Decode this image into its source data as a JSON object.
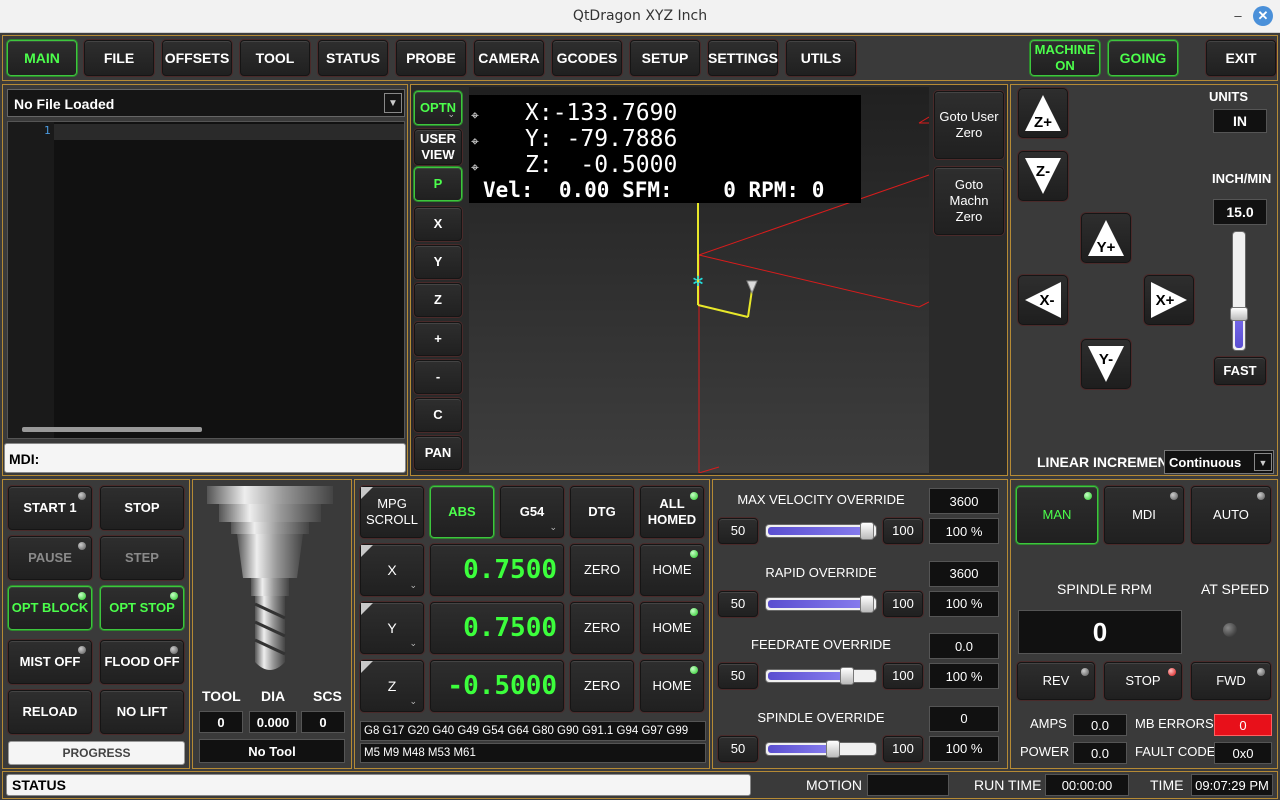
{
  "window": {
    "title": "QtDragon XYZ Inch",
    "minimize_glyph": "–",
    "close_glyph": "✕"
  },
  "tabs": [
    "MAIN",
    "FILE",
    "OFFSETS",
    "TOOL",
    "STATUS",
    "PROBE",
    "CAMERA",
    "GCODES",
    "SETUP",
    "SETTINGS",
    "UTILS"
  ],
  "top_right": {
    "machine_on": "MACHINE ON",
    "going": "GOING",
    "exit": "EXIT"
  },
  "file": {
    "loaded": "No File Loaded",
    "line_number": "1",
    "mdi_label": "MDI:"
  },
  "view_buttons": [
    "OPTN",
    "USER VIEW",
    "P",
    "X",
    "Y",
    "Z",
    "+",
    "-",
    "C",
    "PAN"
  ],
  "dro_overlay": {
    "x": "X:-133.7690",
    "y": "Y: -79.7886",
    "z": "Z:  -0.5000",
    "status_line": "Vel:  0.00 SFM:    0 RPM: 0"
  },
  "goto_buttons": {
    "user_zero": "Goto User Zero",
    "machine_zero": "Goto Machn Zero"
  },
  "jog": {
    "labels": [
      "Z+",
      "Z-",
      "Y+",
      "X-",
      "X+",
      "Y-"
    ],
    "units_label": "UNITS",
    "units_value": "IN",
    "rate_label": "INCH/MIN",
    "rate_value": "15.0",
    "rate_fraction": 0.2,
    "fast_label": "FAST",
    "linear_increment_label": "LINEAR INCREMENT",
    "linear_increment_value": "Continuous"
  },
  "program": {
    "start": "START 1",
    "stop": "STOP",
    "pause": "PAUSE",
    "step": "STEP",
    "opt_block": "OPT BLOCK",
    "opt_stop": "OPT STOP",
    "mist": "MIST OFF",
    "flood": "FLOOD OFF",
    "reload": "RELOAD",
    "no_lift": "NO LIFT",
    "progress": "PROGRESS"
  },
  "tool": {
    "tool_label": "TOOL",
    "dia_label": "DIA",
    "scs_label": "SCS",
    "tool_value": "0",
    "dia_value": "0.000",
    "scs_value": "0",
    "name": "No Tool"
  },
  "dro": {
    "mpg": "MPG SCROLL",
    "abs": "ABS",
    "wcs": "G54",
    "dtg": "DTG",
    "all_homed": "ALL HOMED",
    "axes": [
      {
        "name": "X",
        "value": "0.7500",
        "zero": "ZERO",
        "home": "HOME"
      },
      {
        "name": "Y",
        "value": "0.7500",
        "zero": "ZERO",
        "home": "HOME"
      },
      {
        "name": "Z",
        "value": "-0.5000",
        "zero": "ZERO",
        "home": "HOME"
      }
    ],
    "gcodes": "G8 G17 G20 G40 G49 G54 G64 G80 G90 G91.1 G94 G97 G99",
    "mcodes": "M5 M9 M48 M53 M61"
  },
  "overrides": [
    {
      "title": "MAX VELOCITY OVERRIDE",
      "value": "3600",
      "min": "50",
      "max": "100",
      "percent": "100 %",
      "level": 1.0
    },
    {
      "title": "RAPID OVERRIDE",
      "value": "3600",
      "min": "50",
      "max": "100",
      "percent": "100 %",
      "level": 1.0
    },
    {
      "title": "FEEDRATE OVERRIDE",
      "value": "0.0",
      "min": "50",
      "max": "100",
      "percent": "100 %",
      "level": 0.8
    },
    {
      "title": "SPINDLE OVERRIDE",
      "value": "0",
      "min": "50",
      "max": "100",
      "percent": "100 %",
      "level": 0.67
    }
  ],
  "mode": {
    "man": "MAN",
    "mdi": "MDI",
    "auto": "AUTO"
  },
  "spindle": {
    "rpm_label": "SPINDLE RPM",
    "rpm_value": "0",
    "at_speed": "AT SPEED",
    "rev": "REV",
    "stop": "STOP",
    "fwd": "FWD",
    "amps_label": "AMPS",
    "amps_value": "0.0",
    "power_label": "POWER",
    "power_value": "0.0",
    "mb_errors_label": "MB ERRORS",
    "mb_errors_value": "0",
    "fault_code_label": "FAULT CODE",
    "fault_code_value": "0x0"
  },
  "statusbar": {
    "status": "STATUS",
    "motion_label": "MOTION",
    "motion_value": "",
    "runtime_label": "RUN TIME",
    "runtime_value": "00:00:00",
    "time_label": "TIME",
    "time_value": "09:07:29 PM"
  },
  "colors": {
    "accent_green": "#4cff4c",
    "panel_border": "#b58a35",
    "error_red": "#e8101a",
    "toolpath": "#e8e82a",
    "boundary": "#d81c1c"
  }
}
